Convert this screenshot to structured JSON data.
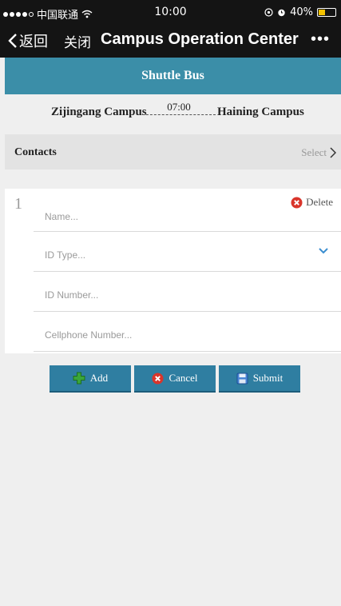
{
  "status_bar": {
    "carrier": "中国联通",
    "time": "10:00",
    "battery": "40%",
    "battery_level": 0.4,
    "icons": [
      "signal-dots-icon",
      "wifi-icon",
      "location-icon",
      "alarm-icon",
      "battery-icon"
    ]
  },
  "nav": {
    "back_label": "返回",
    "close_label": "关闭",
    "title": "Campus Operation Center",
    "more": "•••"
  },
  "header": {
    "title": "Shuttle Bus"
  },
  "route": {
    "from": "Zijingang Campus",
    "time": "07:00",
    "to": "Haining Campus"
  },
  "contacts": {
    "label": "Contacts",
    "select_label": "Select"
  },
  "form": {
    "index": "1",
    "delete_label": "Delete",
    "name_placeholder": "Name...",
    "id_type_placeholder": "ID Type...",
    "id_number_placeholder": "ID Number...",
    "cellphone_placeholder": "Cellphone Number..."
  },
  "actions": {
    "add_label": "Add",
    "cancel_label": "Cancel",
    "submit_label": "Submit"
  },
  "colors": {
    "accent": "#3b8ea8",
    "button": "#2f7ea1",
    "nav_bg": "#141414",
    "battery": "#f3c200",
    "delete_red": "#d9352b",
    "add_green": "#3aa63a"
  }
}
